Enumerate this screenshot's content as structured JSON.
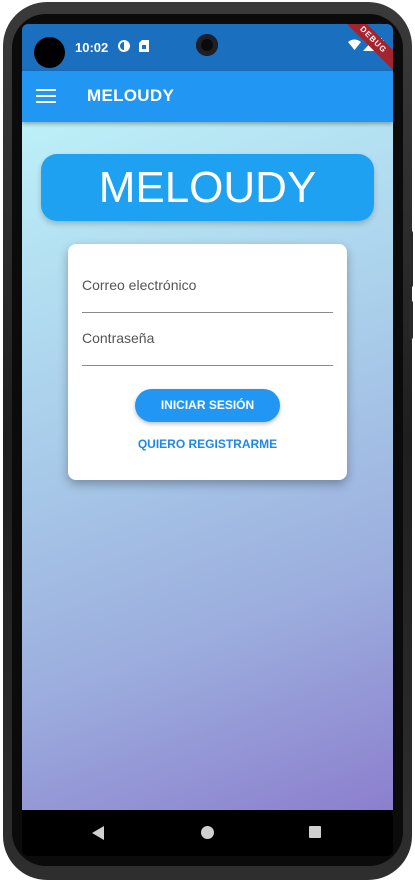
{
  "status_bar": {
    "time": "10:02",
    "debug_banner": "DEBUG",
    "icons": [
      "data-saver-icon",
      "sim-card-icon",
      "wifi-icon",
      "signal-icon",
      "battery-icon"
    ]
  },
  "app_bar": {
    "title": "MELOUDY",
    "menu_icon": "menu-icon"
  },
  "brand": {
    "title": "MELOUDY"
  },
  "login_form": {
    "email_label": "Correo electrónico",
    "password_label": "Contraseña",
    "login_button": "INICIAR SESIÓN",
    "register_link": "QUIERO REGISTRARME"
  },
  "nav_bar": {
    "icons": [
      "back-icon",
      "home-icon",
      "recents-icon"
    ]
  },
  "colors": {
    "app_bar": "#2196f3",
    "status_bar": "#1a6fbf",
    "brand_banner": "#1fa1f2",
    "button": "#2196f3",
    "link": "#1e88e5",
    "gradient_top": "#bdf0f8",
    "gradient_bottom": "#8c7fce"
  }
}
